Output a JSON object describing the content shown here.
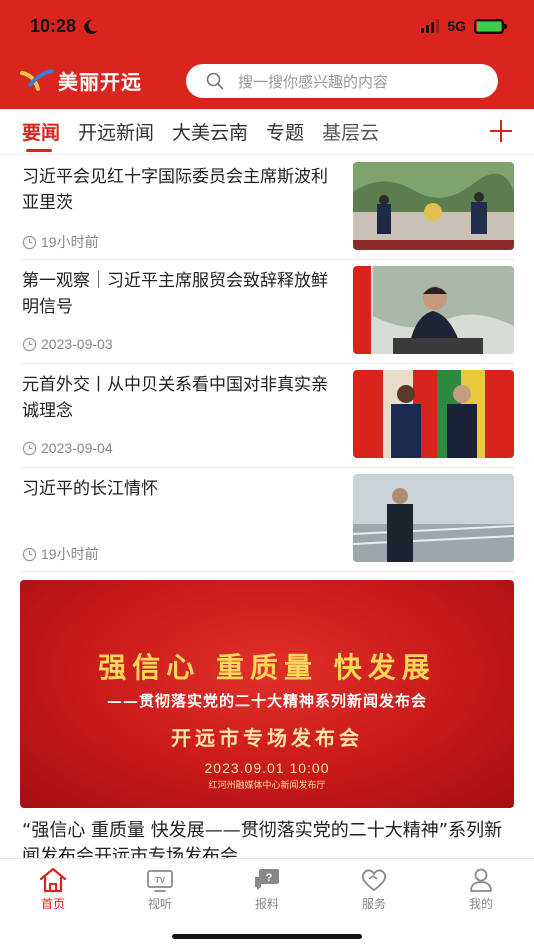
{
  "status_bar": {
    "time": "10:28",
    "network": "5G"
  },
  "header": {
    "brand_name": "美丽开远",
    "search_placeholder": "搜一搜你感兴趣的内容",
    "colors": {
      "brand_red": "#d9251d"
    }
  },
  "tabs": {
    "items": [
      {
        "label": "要闻",
        "active": true
      },
      {
        "label": "开远新闻",
        "active": false
      },
      {
        "label": "大美云南",
        "active": false
      },
      {
        "label": "专题",
        "active": false
      },
      {
        "label": "基层云",
        "active": false
      }
    ]
  },
  "news": [
    {
      "title": "习近平会见红十字国际委员会主席斯波利亚里茨",
      "time": "19小时前"
    },
    {
      "title": "第一观察｜习近平主席服贸会致辞释放鲜明信号",
      "time": "2023-09-03"
    },
    {
      "title": "元首外交丨从中贝关系看中国对非真实亲诚理念",
      "time": "2023-09-04"
    },
    {
      "title": "习近平的长江情怀",
      "time": "19小时前"
    }
  ],
  "banner": {
    "line1": "强信心 重质量 快发展",
    "line2": "——贯彻落实党的二十大精神系列新闻发布会",
    "line3": "开远市专场发布会",
    "date": "2023.09.01 10:00",
    "venue": "红河州融媒体中心新闻发布厅"
  },
  "feature_title": "“强信心 重质量 快发展——贯彻落实党的二十大精神”系列新闻发布会开远市专场发布会",
  "bottom_nav": [
    {
      "label": "首页",
      "icon": "home-icon",
      "active": true
    },
    {
      "label": "视听",
      "icon": "tv-icon",
      "active": false
    },
    {
      "label": "报料",
      "icon": "report-icon",
      "active": false
    },
    {
      "label": "服务",
      "icon": "heart-icon",
      "active": false
    },
    {
      "label": "我的",
      "icon": "user-icon",
      "active": false
    }
  ]
}
